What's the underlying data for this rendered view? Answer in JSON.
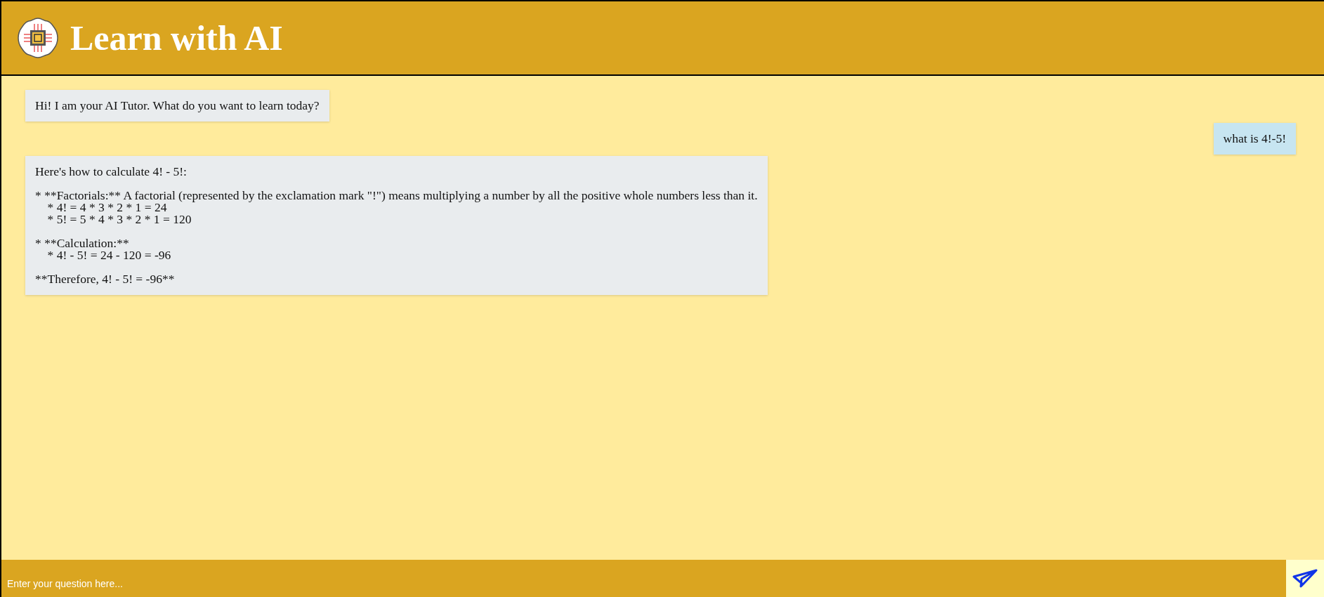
{
  "header": {
    "title": "Learn with AI"
  },
  "messages": [
    {
      "kind": "bot",
      "text": "Hi! I am your AI Tutor. What do you want to learn today?"
    },
    {
      "kind": "user",
      "text": "what is 4!-5!"
    },
    {
      "kind": "bot",
      "text": "Here's how to calculate 4! - 5!:\n\n* **Factorials:** A factorial (represented by the exclamation mark \"!\") means multiplying a number by all the positive whole numbers less than it.\n    * 4! = 4 * 3 * 2 * 1 = 24\n    * 5! = 5 * 4 * 3 * 2 * 1 = 120\n\n* **Calculation:**\n    * 4! - 5! = 24 - 120 = -96\n\n**Therefore, 4! - 5! = -96**"
    }
  ],
  "input": {
    "placeholder": "Enter your question here..."
  }
}
